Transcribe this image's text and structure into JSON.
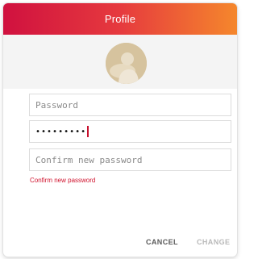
{
  "dialog": {
    "title": "Profile"
  },
  "form": {
    "current_password_placeholder": "Password",
    "new_password_value": "•••••••••",
    "confirm_password_placeholder": "Confirm new password",
    "error_message": "Confirm new password"
  },
  "actions": {
    "cancel_label": "CANCEL",
    "change_label": "CHANGE"
  },
  "colors": {
    "header_start": "#d0113f",
    "header_end": "#f5872c",
    "error": "#d0112c",
    "disabled": "#b9b9b9"
  },
  "icons": {
    "avatar": "user-avatar-icon"
  }
}
